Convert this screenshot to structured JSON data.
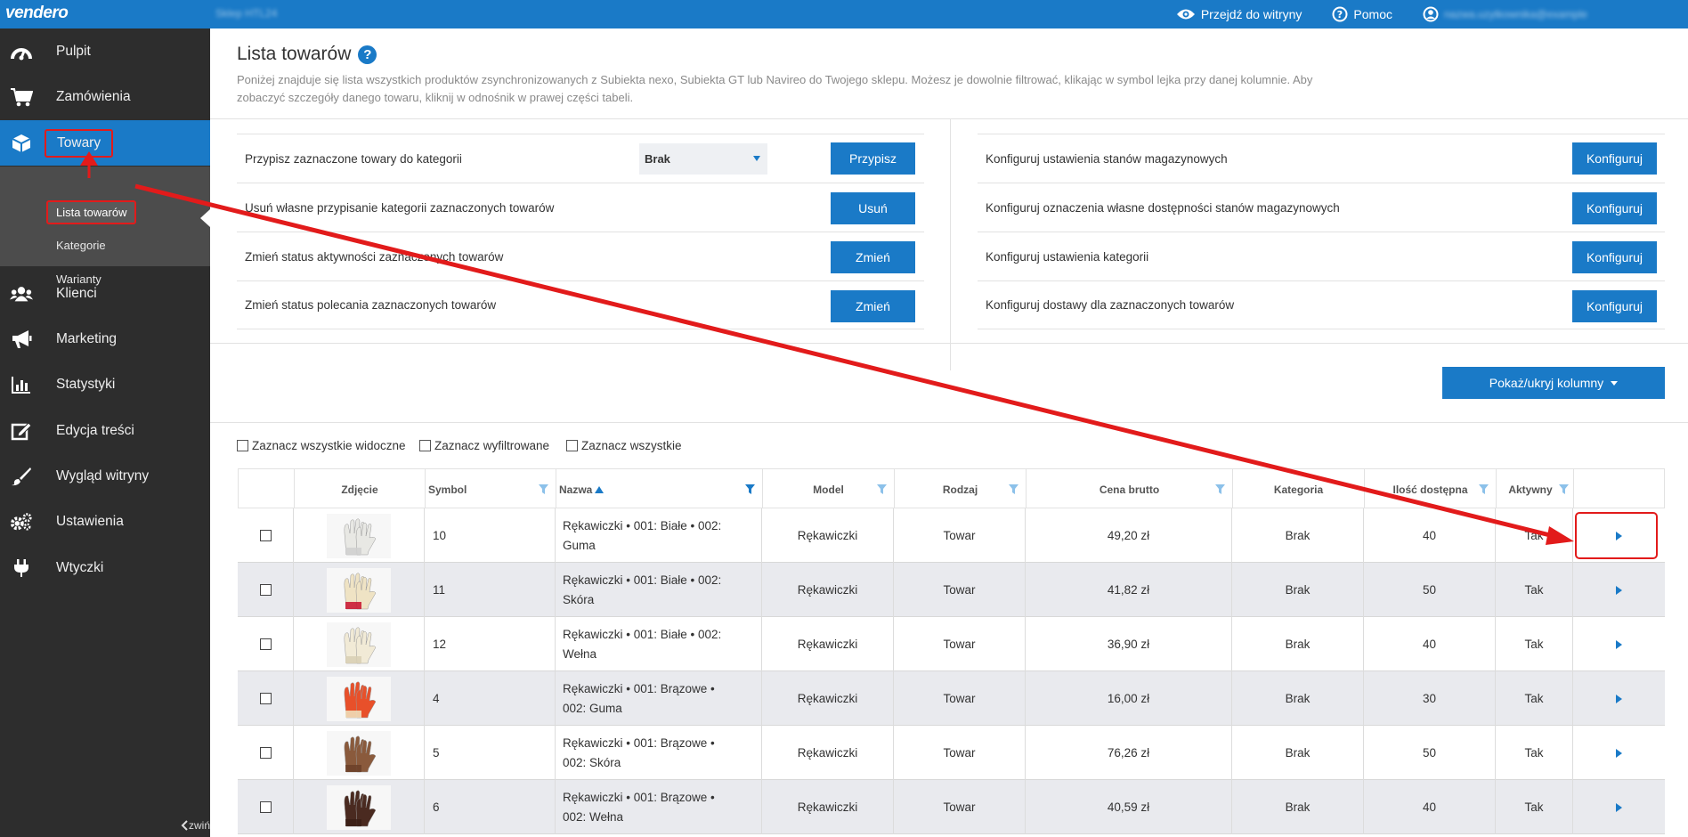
{
  "topbar": {
    "logo": "vendero",
    "store_name": "Sklep HTL24",
    "visit_site": "Przejdź do witryny",
    "help": "Pomoc",
    "user": "nazwa.uzytkownika@example"
  },
  "sidebar": {
    "items": [
      {
        "label": "Pulpit",
        "icon": "dashboard-icon"
      },
      {
        "label": "Zamówienia",
        "icon": "cart-icon"
      },
      {
        "label": "Towary",
        "icon": "box-icon"
      },
      {
        "label": "Klienci",
        "icon": "users-icon"
      },
      {
        "label": "Marketing",
        "icon": "megaphone-icon"
      },
      {
        "label": "Statystyki",
        "icon": "chart-icon"
      },
      {
        "label": "Edycja treści",
        "icon": "edit-icon"
      },
      {
        "label": "Wygląd witryny",
        "icon": "brush-icon"
      },
      {
        "label": "Ustawienia",
        "icon": "gears-icon"
      },
      {
        "label": "Wtyczki",
        "icon": "plug-icon"
      }
    ],
    "sub_items": [
      {
        "label": "Lista towarów"
      },
      {
        "label": "Kategorie"
      },
      {
        "label": "Warianty"
      }
    ],
    "collapse": "zwiń"
  },
  "page": {
    "title": "Lista towarów",
    "description": "Poniżej znajduje się lista wszystkich produktów zsynchronizowanych z Subiekta nexo, Subiekta GT lub Navireo do Twojego sklepu. Możesz je dowolnie filtrować, klikając w symbol lejka przy danej kolumnie. Aby zobaczyć szczegóły danego towaru, kliknij w odnośnik w prawej części tabeli."
  },
  "actions_left": [
    {
      "label": "Przypisz zaznaczone towary do kategorii",
      "button": "Przypisz",
      "select": "Brak"
    },
    {
      "label": "Usuń własne przypisanie kategorii zaznaczonych towarów",
      "button": "Usuń"
    },
    {
      "label": "Zmień status aktywności zaznaczonych towarów",
      "button": "Zmień"
    },
    {
      "label": "Zmień status polecania zaznaczonych towarów",
      "button": "Zmień"
    }
  ],
  "actions_right": [
    {
      "label": "Konfiguruj ustawienia stanów magazynowych",
      "button": "Konfiguruj"
    },
    {
      "label": "Konfiguruj oznaczenia własne dostępności stanów magazynowych",
      "button": "Konfiguruj"
    },
    {
      "label": "Konfiguruj ustawienia kategorii",
      "button": "Konfiguruj"
    },
    {
      "label": "Konfiguruj dostawy dla zaznaczonych towarów",
      "button": "Konfiguruj"
    }
  ],
  "columns_button": "Pokaż/ukryj kolumny",
  "select_all": {
    "visible": "Zaznacz wszystkie widoczne",
    "filtered": "Zaznacz wyfiltrowane",
    "all": "Zaznacz wszystkie"
  },
  "table": {
    "headers": {
      "photo": "Zdjęcie",
      "symbol": "Symbol",
      "name": "Nazwa",
      "model": "Model",
      "type": "Rodzaj",
      "price": "Cena brutto",
      "category": "Kategoria",
      "qty": "Ilość dostępna",
      "active": "Aktywny"
    },
    "rows": [
      {
        "symbol": "10",
        "name": "Rękawiczki • 001: Białe • 002: Guma",
        "model": "Rękawiczki",
        "type": "Towar",
        "price": "49,20 zł",
        "category": "Brak",
        "qty": "40",
        "active": "Tak",
        "glove_color": "#e8e8e4",
        "accent": "#cfcfcf"
      },
      {
        "symbol": "11",
        "name": "Rękawiczki • 001: Białe • 002: Skóra",
        "model": "Rękawiczki",
        "type": "Towar",
        "price": "41,82 zł",
        "category": "Brak",
        "qty": "50",
        "active": "Tak",
        "glove_color": "#efe3c4",
        "accent": "#c8102e"
      },
      {
        "symbol": "12",
        "name": "Rękawiczki • 001: Białe • 002: Wełna",
        "model": "Rękawiczki",
        "type": "Towar",
        "price": "36,90 zł",
        "category": "Brak",
        "qty": "40",
        "active": "Tak",
        "glove_color": "#f1ead6",
        "accent": "#d8cfb4"
      },
      {
        "symbol": "4",
        "name": "Rękawiczki • 001: Brązowe • 002: Guma",
        "model": "Rękawiczki",
        "type": "Towar",
        "price": "16,00 zł",
        "category": "Brak",
        "qty": "30",
        "active": "Tak",
        "glove_color": "#e8502a",
        "accent": "#f0e4c0"
      },
      {
        "symbol": "5",
        "name": "Rękawiczki • 001: Brązowe • 002: Skóra",
        "model": "Rękawiczki",
        "type": "Towar",
        "price": "76,26 zł",
        "category": "Brak",
        "qty": "50",
        "active": "Tak",
        "glove_color": "#8a5a3c",
        "accent": "#6b4028"
      },
      {
        "symbol": "6",
        "name": "Rękawiczki • 001: Brązowe • 002: Wełna",
        "model": "Rękawiczki",
        "type": "Towar",
        "price": "40,59 zł",
        "category": "Brak",
        "qty": "40",
        "active": "Tak",
        "glove_color": "#4a2a20",
        "accent": "#3a1e16"
      }
    ]
  },
  "colors": {
    "brand": "#1a7ac7",
    "sidebar": "#2d2d2d",
    "annotation": "#e21b1b"
  }
}
